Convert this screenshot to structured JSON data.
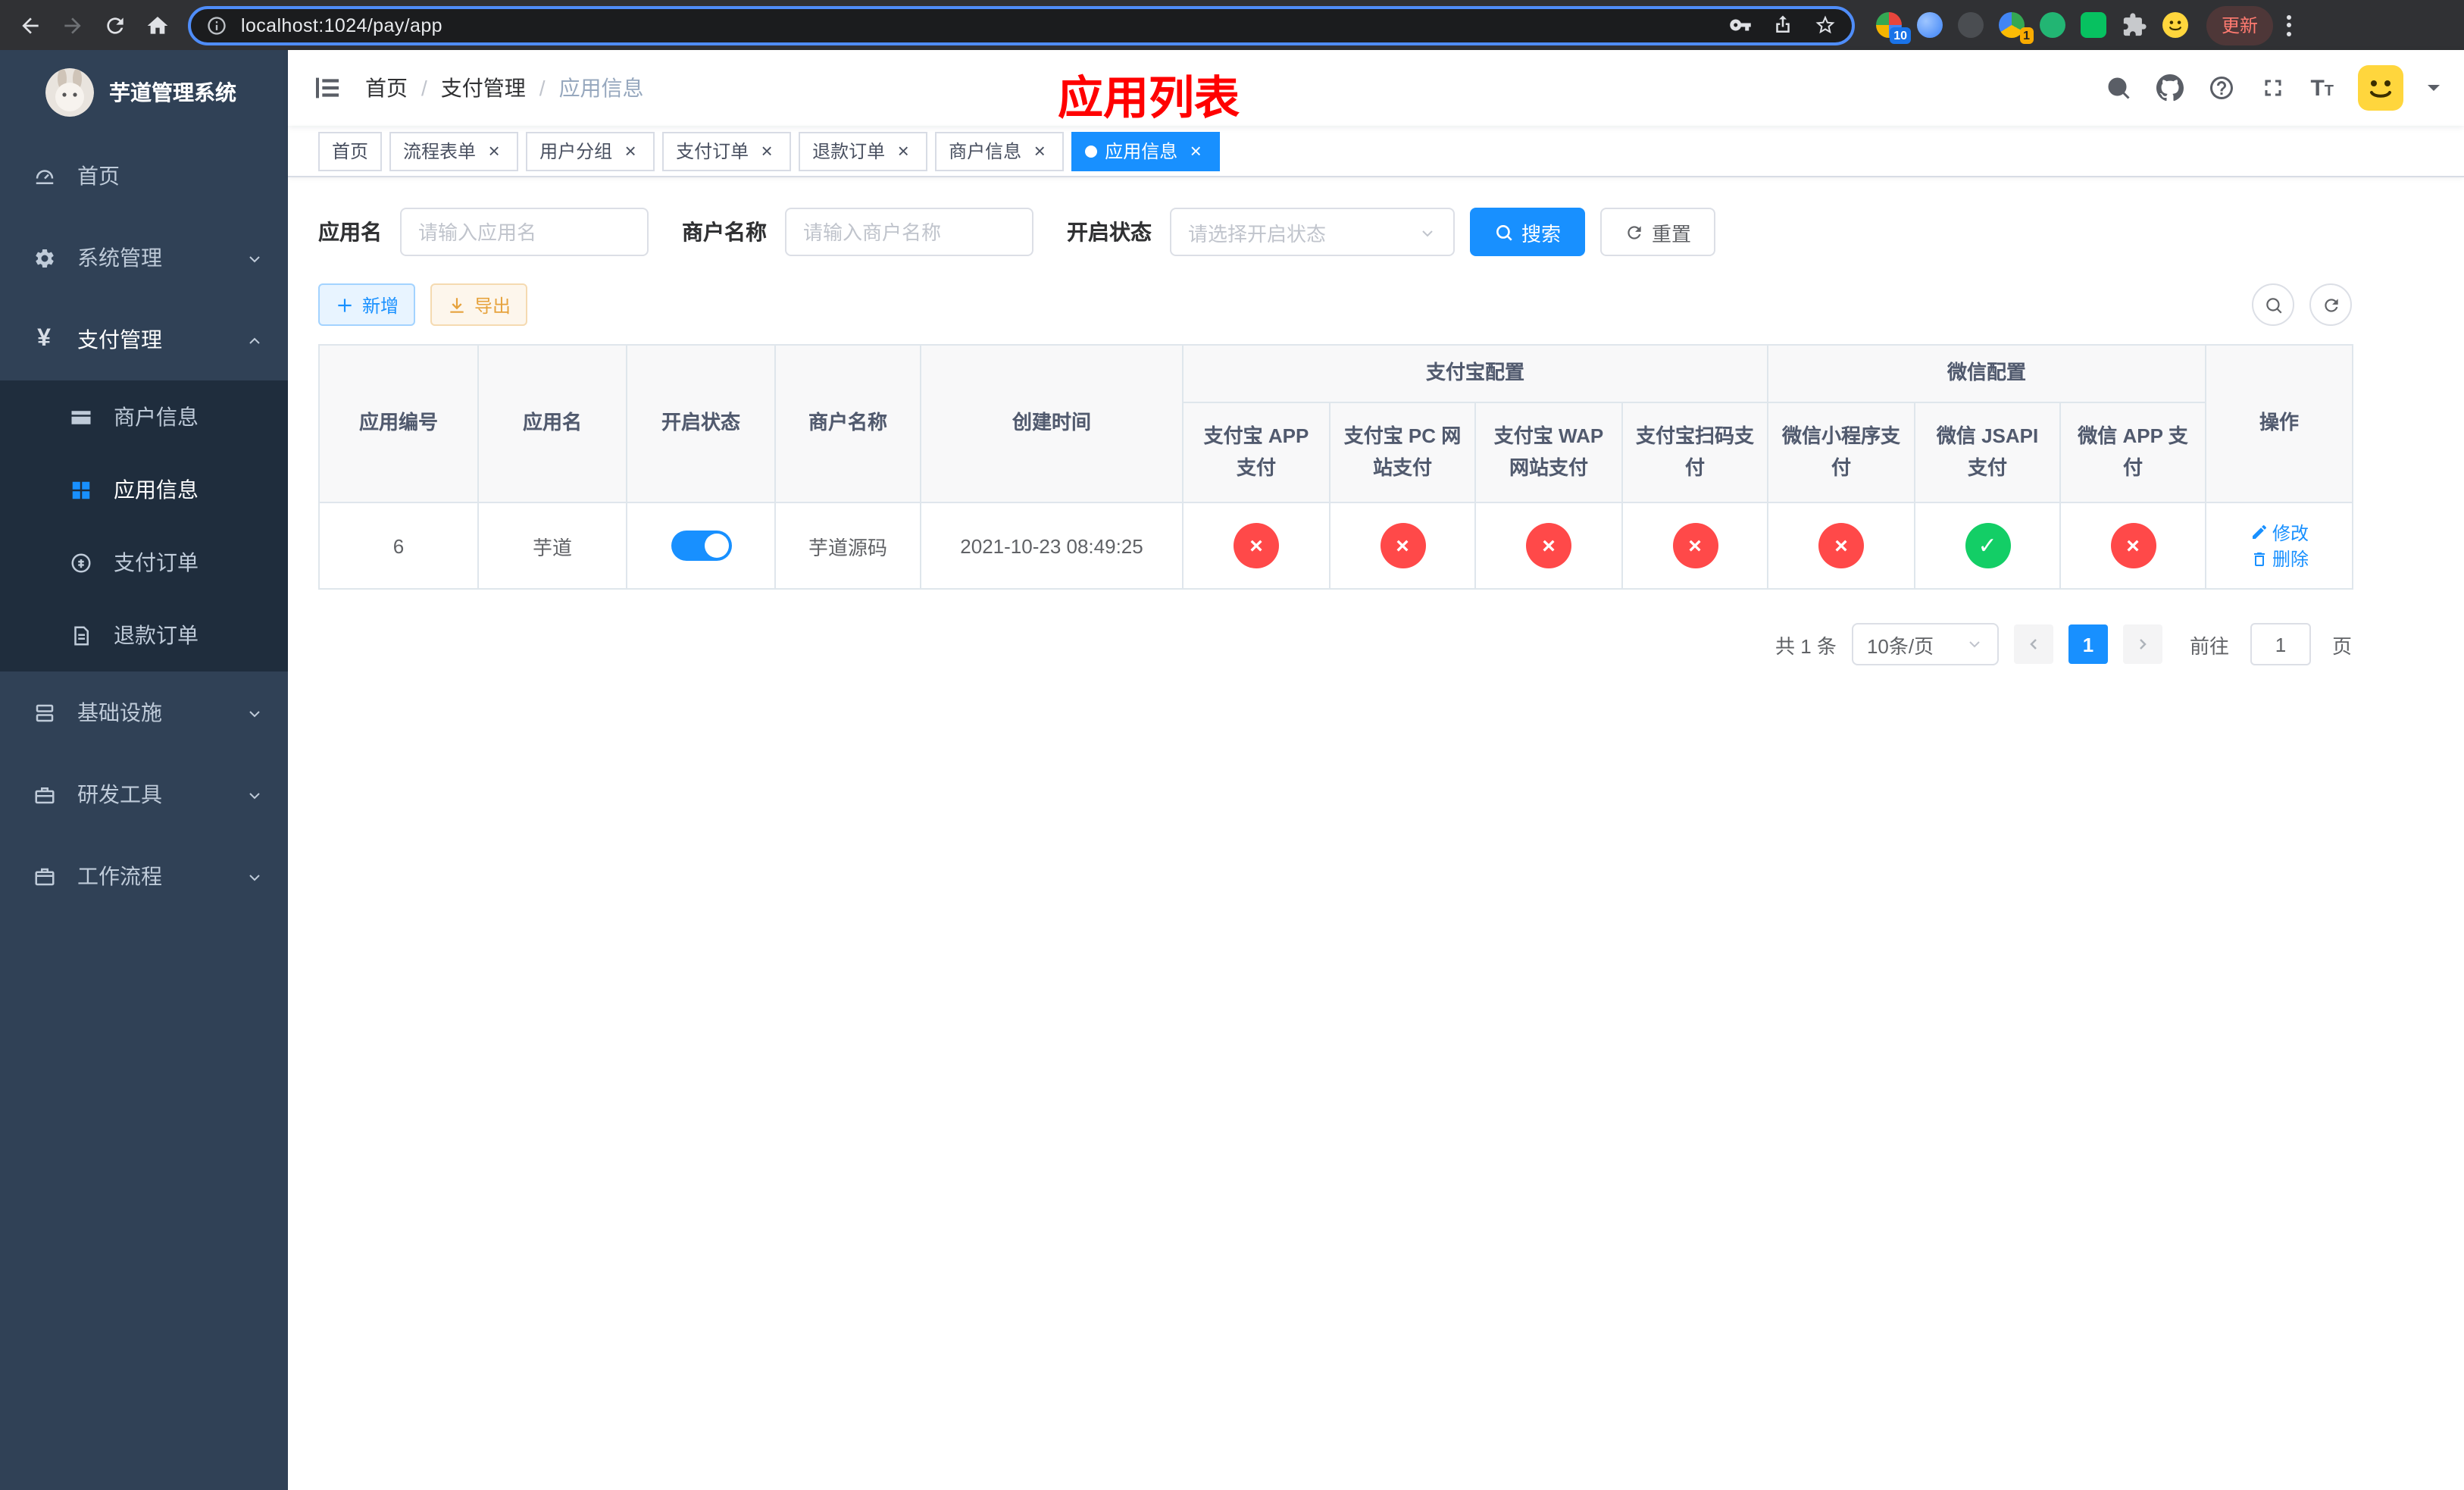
{
  "browser": {
    "url": "localhost:1024/pay/app",
    "update_label": "更新",
    "ext_badges": [
      "10",
      "1"
    ]
  },
  "sidebar": {
    "title": "芋道管理系统",
    "items": [
      {
        "label": "首页"
      },
      {
        "label": "系统管理"
      },
      {
        "label": "支付管理"
      },
      {
        "label": "基础设施"
      },
      {
        "label": "研发工具"
      },
      {
        "label": "工作流程"
      }
    ],
    "pay_children": [
      {
        "label": "商户信息"
      },
      {
        "label": "应用信息"
      },
      {
        "label": "支付订单"
      },
      {
        "label": "退款订单"
      }
    ]
  },
  "header": {
    "breadcrumb": [
      "首页",
      "支付管理",
      "应用信息"
    ],
    "title": "应用列表"
  },
  "tabs": [
    {
      "label": "首页"
    },
    {
      "label": "流程表单"
    },
    {
      "label": "用户分组"
    },
    {
      "label": "支付订单"
    },
    {
      "label": "退款订单"
    },
    {
      "label": "商户信息"
    },
    {
      "label": "应用信息"
    }
  ],
  "filters": {
    "app_name_label": "应用名",
    "app_name_placeholder": "请输入应用名",
    "merchant_label": "商户名称",
    "merchant_placeholder": "请输入商户名称",
    "status_label": "开启状态",
    "status_placeholder": "请选择开启状态",
    "search_label": "搜索",
    "reset_label": "重置"
  },
  "toolbar": {
    "add_label": "新增",
    "export_label": "导出"
  },
  "table": {
    "groups": {
      "alipay": "支付宝配置",
      "wechat": "微信配置"
    },
    "columns": {
      "app_id": "应用编号",
      "app_name": "应用名",
      "status": "开启状态",
      "merchant": "商户名称",
      "create_time": "创建时间",
      "alipay_app": "支付宝 APP 支付",
      "alipay_pc": "支付宝 PC 网站支付",
      "alipay_wap": "支付宝 WAP 网站支付",
      "alipay_qr": "支付宝扫码支付",
      "wx_mini": "微信小程序支付",
      "wx_jsapi": "微信 JSAPI 支付",
      "wx_app": "微信 APP 支付",
      "actions": "操作"
    },
    "rows": [
      {
        "app_id": "6",
        "app_name": "芋道",
        "status_on": true,
        "merchant": "芋道源码",
        "create_time": "2021-10-23 08:49:25",
        "alipay_app": false,
        "alipay_pc": false,
        "alipay_wap": false,
        "alipay_qr": false,
        "wx_mini": false,
        "wx_jsapi": true,
        "wx_app": false,
        "edit_label": "修改",
        "delete_label": "删除"
      }
    ]
  },
  "glyphs": {
    "pass": "✓",
    "fail": "×"
  },
  "pagination": {
    "total": "共 1 条",
    "page_size": "10条/页",
    "page": "1",
    "goto_label": "前往",
    "goto_value": "1",
    "goto_unit": "页"
  }
}
